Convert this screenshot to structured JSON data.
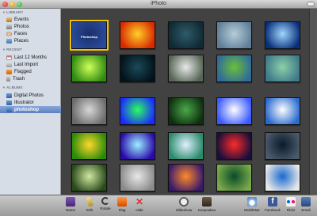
{
  "window": {
    "title": "iPhoto"
  },
  "sidebar": {
    "sections": [
      {
        "heading": "LIBRARY",
        "items": [
          {
            "label": "Events",
            "icon": "events-icon"
          },
          {
            "label": "Photos",
            "icon": "photos-icon"
          },
          {
            "label": "Faces",
            "icon": "faces-icon"
          },
          {
            "label": "Places",
            "icon": "places-icon"
          }
        ]
      },
      {
        "heading": "RECENT",
        "items": [
          {
            "label": "Last 12 Months",
            "icon": "calendar-icon"
          },
          {
            "label": "Last Import",
            "icon": "import-icon"
          },
          {
            "label": "Flagged",
            "icon": "flag-icon"
          },
          {
            "label": "Trash",
            "icon": "trash-icon"
          }
        ]
      },
      {
        "heading": "ALBUMS",
        "items": [
          {
            "label": "Digital Photos",
            "icon": "album-icon"
          },
          {
            "label": "Illustrator",
            "icon": "album-icon"
          },
          {
            "label": "photoshop",
            "icon": "album-icon",
            "selected": true
          }
        ]
      }
    ]
  },
  "grid": {
    "selected_caption": "Photoshop",
    "thumbnails": [
      {
        "colors": [
          "#1b2f6a",
          "#2a4a9a"
        ],
        "selected": true
      },
      {
        "colors": [
          "#ffcf2a",
          "#d82a00"
        ]
      },
      {
        "colors": [
          "#2f5a6a",
          "#0f2a33"
        ]
      },
      {
        "colors": [
          "#b7cdd8",
          "#5f7f99"
        ]
      },
      {
        "colors": [
          "#9fd7ff",
          "#0a2f7a"
        ]
      },
      {
        "colors": [
          "#cfff5a",
          "#2f8a10"
        ]
      },
      {
        "colors": [
          "#1a4a5a",
          "#03121a"
        ]
      },
      {
        "colors": [
          "#e8e8e8",
          "#556655"
        ]
      },
      {
        "colors": [
          "#6abf3a",
          "#2f6a9a"
        ]
      },
      {
        "colors": [
          "#8ad0a8",
          "#3f7a8a"
        ]
      },
      {
        "colors": [
          "#d8d8d8",
          "#6a6a6a"
        ]
      },
      {
        "colors": [
          "#2aff5a",
          "#1a2aff"
        ]
      },
      {
        "colors": [
          "#4aa84a",
          "#0f2f0f"
        ]
      },
      {
        "colors": [
          "#ffffff",
          "#3a5aff"
        ]
      },
      {
        "colors": [
          "#ffffff",
          "#2a6acf"
        ]
      },
      {
        "colors": [
          "#ffd82a",
          "#2a8a0a"
        ]
      },
      {
        "colors": [
          "#9af0ff",
          "#2a0aaa"
        ]
      },
      {
        "colors": [
          "#e0f0ff",
          "#2a8a6a"
        ]
      },
      {
        "colors": [
          "#ff2a2a",
          "#1a0f3a"
        ]
      },
      {
        "colors": [
          "#0a1a2a",
          "#4a5a6a"
        ]
      },
      {
        "colors": [
          "#cfe8a0",
          "#2a4a1a"
        ]
      },
      {
        "colors": [
          "#e8e8e8",
          "#8a8a8a"
        ]
      },
      {
        "colors": [
          "#ff8a2a",
          "#3a1a6a"
        ]
      },
      {
        "colors": [
          "#0a4a2a",
          "#7aaa4a"
        ]
      },
      {
        "colors": [
          "#1a6acf",
          "#e8e8e8"
        ]
      }
    ]
  },
  "toolbar": {
    "left": [
      {
        "label": "Name",
        "icon": "name-icon"
      },
      {
        "label": "Edit",
        "icon": "edit-icon"
      },
      {
        "label": "Rotate",
        "icon": "rotate-icon"
      },
      {
        "label": "Flag",
        "icon": "flag-icon"
      },
      {
        "label": "Hide",
        "icon": "hide-icon",
        "glyph": "✕"
      }
    ],
    "center": [
      {
        "label": "Slideshow",
        "icon": "slideshow-icon"
      },
      {
        "label": "Keepsakes",
        "icon": "keepsakes-icon"
      }
    ],
    "right": [
      {
        "label": "MobileMe",
        "icon": "mobileme-icon"
      },
      {
        "label": "Facebook",
        "icon": "facebook-icon",
        "glyph": "f"
      },
      {
        "label": "Flickr",
        "icon": "flickr-icon"
      },
      {
        "label": "Email",
        "icon": "email-icon"
      }
    ]
  }
}
